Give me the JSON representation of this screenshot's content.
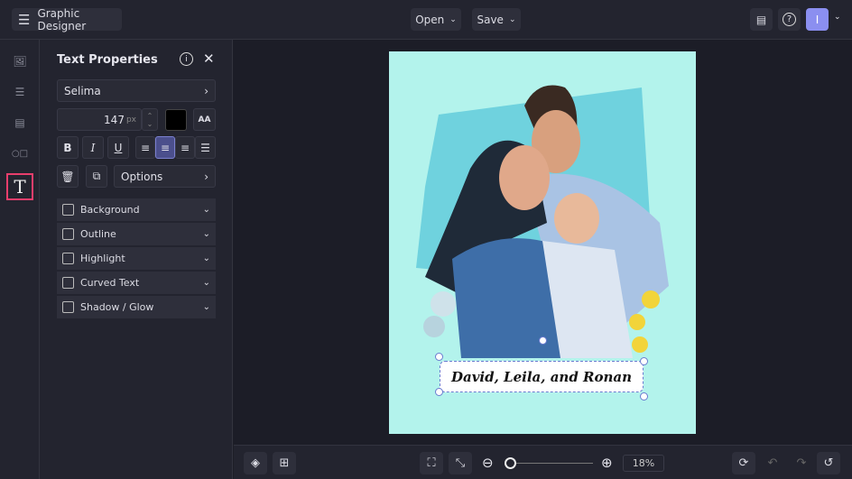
{
  "header": {
    "app_title": "Graphic Designer",
    "open_label": "Open",
    "save_label": "Save",
    "avatar_initial": "I"
  },
  "panel": {
    "title": "Text Properties",
    "font": "Selima",
    "size_value": "147",
    "size_unit": "px",
    "text_color": "#000000",
    "options_label": "Options",
    "accordions": [
      {
        "label": "Background"
      },
      {
        "label": "Outline"
      },
      {
        "label": "Highlight"
      },
      {
        "label": "Curved Text"
      },
      {
        "label": "Shadow / Glow"
      }
    ]
  },
  "canvas": {
    "background_color": "#b3f3ec",
    "caption_text": "David, Leila, and Ronan"
  },
  "zoom": {
    "label": "18%",
    "value_percent": 18
  },
  "colors": {
    "accent": "#e83e6c",
    "active_align": "#4b4f8c"
  }
}
